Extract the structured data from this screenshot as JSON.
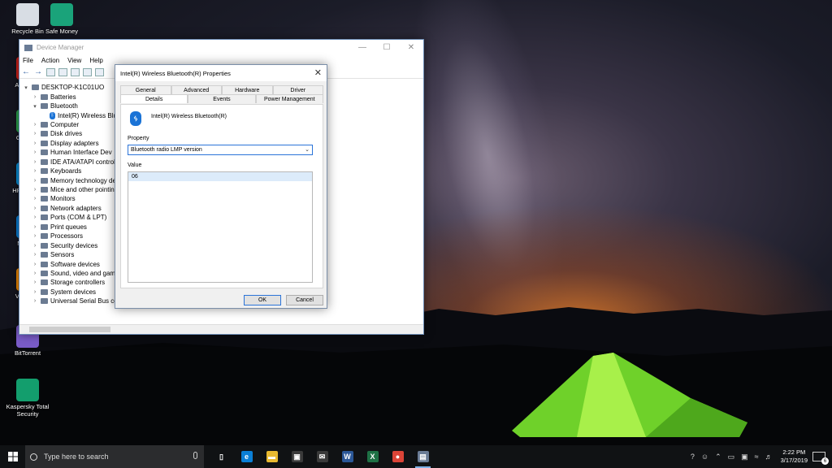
{
  "desktop_icons": [
    {
      "label": "Recycle Bin",
      "icon": "recycle-bin-icon",
      "color": "#d8dde4"
    },
    {
      "label": "Safe Money",
      "icon": "safe-money-icon",
      "color": "#1aa37a"
    },
    {
      "label": "Acr Read",
      "icon": "acrobat-icon",
      "color": "#d2221b"
    },
    {
      "label": "Goo Chr",
      "icon": "chrome-icon",
      "color": "#2ea44f"
    },
    {
      "label": "HP Su Assi",
      "icon": "hp-support-icon",
      "color": "#0a8fd6"
    },
    {
      "label": "Micr Ed",
      "icon": "edge-icon",
      "color": "#0a7fd6"
    },
    {
      "label": "VLC play",
      "icon": "vlc-icon",
      "color": "#f08a00"
    },
    {
      "label": "BitTorrent",
      "icon": "bittorrent-icon",
      "color": "#7a5cc8"
    },
    {
      "label": "Kaspersky Total Security",
      "icon": "kaspersky-icon",
      "color": "#139e6d"
    }
  ],
  "device_manager": {
    "title": "Device Manager",
    "menu": [
      "File",
      "Action",
      "View",
      "Help"
    ],
    "tree": [
      {
        "label": "DESKTOP-K1C01UO",
        "expander": "▾",
        "level": 0
      },
      {
        "label": "Batteries",
        "expander": "›",
        "level": 1
      },
      {
        "label": "Bluetooth",
        "expander": "▾",
        "level": 1
      },
      {
        "label": "Intel(R) Wireless Blu",
        "expander": "",
        "level": 2,
        "bt": true
      },
      {
        "label": "Computer",
        "expander": "›",
        "level": 1
      },
      {
        "label": "Disk drives",
        "expander": "›",
        "level": 1
      },
      {
        "label": "Display adapters",
        "expander": "›",
        "level": 1
      },
      {
        "label": "Human Interface Dev",
        "expander": "›",
        "level": 1
      },
      {
        "label": "IDE ATA/ATAPI controll",
        "expander": "›",
        "level": 1
      },
      {
        "label": "Keyboards",
        "expander": "›",
        "level": 1
      },
      {
        "label": "Memory technology de",
        "expander": "›",
        "level": 1
      },
      {
        "label": "Mice and other pointin",
        "expander": "›",
        "level": 1
      },
      {
        "label": "Monitors",
        "expander": "›",
        "level": 1
      },
      {
        "label": "Network adapters",
        "expander": "›",
        "level": 1
      },
      {
        "label": "Ports (COM & LPT)",
        "expander": "›",
        "level": 1
      },
      {
        "label": "Print queues",
        "expander": "›",
        "level": 1
      },
      {
        "label": "Processors",
        "expander": "›",
        "level": 1
      },
      {
        "label": "Security devices",
        "expander": "›",
        "level": 1
      },
      {
        "label": "Sensors",
        "expander": "›",
        "level": 1
      },
      {
        "label": "Software devices",
        "expander": "›",
        "level": 1
      },
      {
        "label": "Sound, video and gam",
        "expander": "›",
        "level": 1
      },
      {
        "label": "Storage controllers",
        "expander": "›",
        "level": 1
      },
      {
        "label": "System devices",
        "expander": "›",
        "level": 1
      },
      {
        "label": "Universal Serial Bus co",
        "expander": "›",
        "level": 1
      }
    ]
  },
  "properties": {
    "title": "Intel(R) Wireless Bluetooth(R) Properties",
    "tabs_row1": [
      "General",
      "Advanced",
      "Hardware",
      "Driver"
    ],
    "tabs_row2": [
      "Details",
      "Events",
      "Power Management"
    ],
    "active_tab": "Details",
    "device_name": "Intel(R) Wireless Bluetooth(R)",
    "property_label": "Property",
    "property_value": "Bluetooth radio LMP version",
    "value_label": "Value",
    "values": [
      "06"
    ],
    "ok_label": "OK",
    "cancel_label": "Cancel"
  },
  "taskbar": {
    "search_placeholder": "Type here to search",
    "apps": [
      {
        "name": "task-view-icon",
        "glyph": "▯",
        "color": "#101214"
      },
      {
        "name": "edge-icon",
        "glyph": "e",
        "color": "#0a7fd6"
      },
      {
        "name": "file-explorer-icon",
        "glyph": "▬",
        "color": "#e8b930"
      },
      {
        "name": "store-icon",
        "glyph": "▣",
        "color": "#3a3a3a"
      },
      {
        "name": "mail-icon",
        "glyph": "✉",
        "color": "#3a3a3a"
      },
      {
        "name": "word-icon",
        "glyph": "W",
        "color": "#2b5797"
      },
      {
        "name": "excel-icon",
        "glyph": "X",
        "color": "#1e7145"
      },
      {
        "name": "chrome-icon",
        "glyph": "●",
        "color": "#db4437"
      },
      {
        "name": "device-manager-icon",
        "glyph": "▤",
        "color": "#6a7c96"
      }
    ],
    "time": "2:22 PM",
    "date": "3/17/2019",
    "notification_count": "6"
  }
}
